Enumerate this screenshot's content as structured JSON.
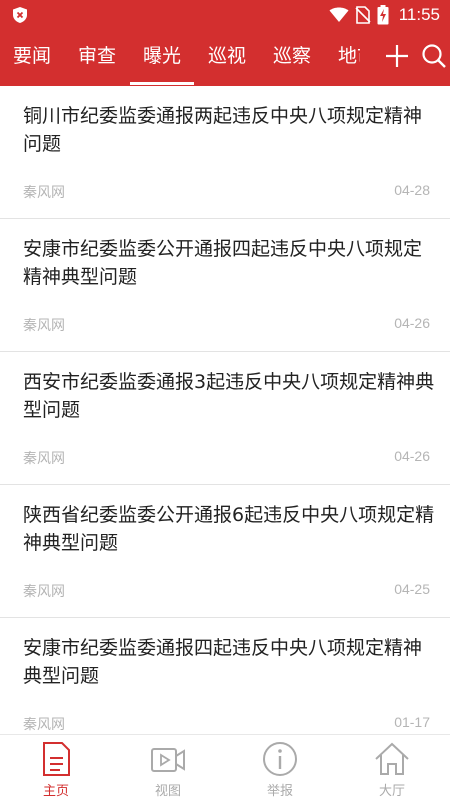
{
  "status_bar": {
    "time": "11:55"
  },
  "tabs": [
    "要闻",
    "审查",
    "曝光",
    "巡视",
    "巡察",
    "地市"
  ],
  "active_tab": "曝光",
  "news": [
    {
      "title": "铜川市纪委监委通报两起违反中央八项规定精神问题",
      "source": "秦风网",
      "date": "04-28"
    },
    {
      "title": "安康市纪委监委公开通报四起违反中央八项规定精神典型问题",
      "source": "秦风网",
      "date": "04-26"
    },
    {
      "title": "西安市纪委监委通报3起违反中央八项规定精神典型问题",
      "source": "秦风网",
      "date": "04-26"
    },
    {
      "title": "陕西省纪委监委公开通报6起违反中央八项规定精神典型问题",
      "source": "秦风网",
      "date": "04-25"
    },
    {
      "title": "安康市纪委监委通报四起违反中央八项规定精神典型问题",
      "source": "秦风网",
      "date": "01-17"
    }
  ],
  "bottom_nav": [
    {
      "label": "主页",
      "icon": "document-icon",
      "active": true
    },
    {
      "label": "视图",
      "icon": "video-icon",
      "active": false
    },
    {
      "label": "举报",
      "icon": "info-icon",
      "active": false
    },
    {
      "label": "大厅",
      "icon": "home-icon",
      "active": false
    }
  ],
  "colors": {
    "brand": "#d32f2f",
    "text": "#222222",
    "muted": "#b5b5b5",
    "inactive_nav": "#aaaaaa"
  }
}
